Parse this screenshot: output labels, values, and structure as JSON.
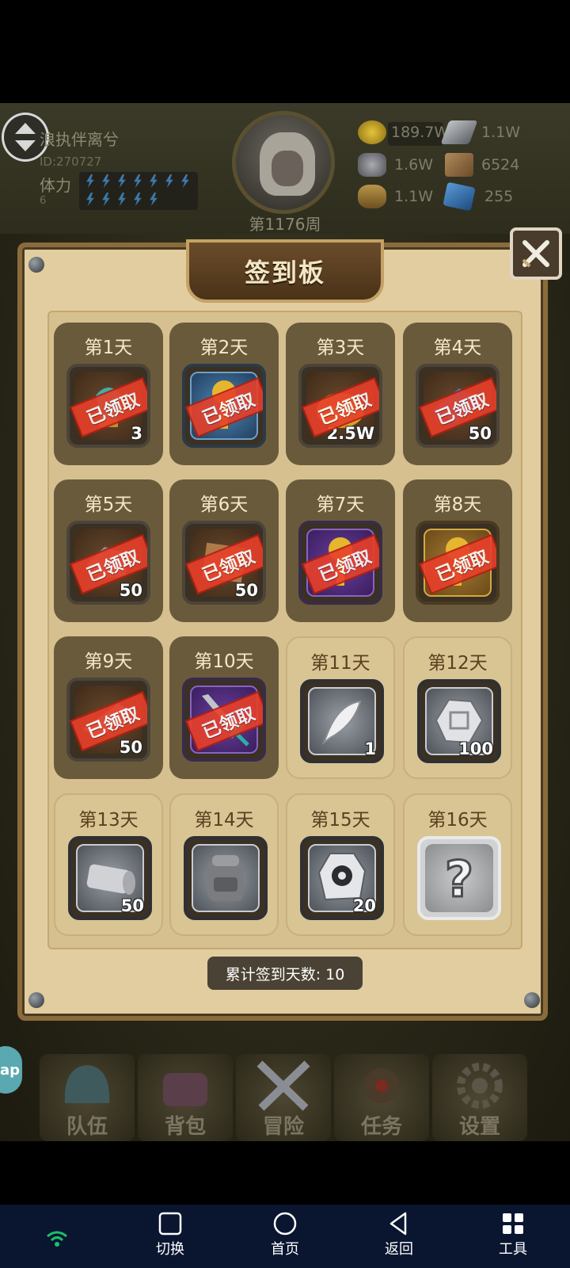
{
  "header": {
    "player_name": "浪执伴离兮",
    "player_id": "ID:270727",
    "stamina_label": "体力",
    "stamina_value": "6",
    "week_label": "第1176周"
  },
  "resources": [
    {
      "name": "gold",
      "value": "189.7W"
    },
    {
      "name": "iron-ingot",
      "value": "1.1W"
    },
    {
      "name": "stone",
      "value": "1.6W"
    },
    {
      "name": "cloth",
      "value": "6524"
    },
    {
      "name": "wood",
      "value": "1.1W"
    },
    {
      "name": "crystal",
      "value": "255"
    }
  ],
  "panel": {
    "title": "签到板",
    "total_label": "累计签到天数: 10",
    "claimed_stamp": "已领取"
  },
  "days": [
    {
      "label": "第1天",
      "qty": "3",
      "claimed": true,
      "icon": "gem-trophy-icon"
    },
    {
      "label": "第2天",
      "qty": "",
      "claimed": true,
      "icon": "key-icon"
    },
    {
      "label": "第3天",
      "qty": "2.5W",
      "claimed": true,
      "icon": "gold-bag-icon"
    },
    {
      "label": "第4天",
      "qty": "50",
      "claimed": true,
      "icon": "crystal-ore-icon"
    },
    {
      "label": "第5天",
      "qty": "50",
      "claimed": true,
      "icon": "stone-ore-icon"
    },
    {
      "label": "第6天",
      "qty": "50",
      "claimed": true,
      "icon": "cloth-icon"
    },
    {
      "label": "第7天",
      "qty": "",
      "claimed": true,
      "icon": "key-icon"
    },
    {
      "label": "第8天",
      "qty": "",
      "claimed": true,
      "icon": "key-icon"
    },
    {
      "label": "第9天",
      "qty": "50",
      "claimed": true,
      "icon": "iron-ingot-icon"
    },
    {
      "label": "第10天",
      "qty": "",
      "claimed": true,
      "icon": "dagger-icon"
    },
    {
      "label": "第11天",
      "qty": "1",
      "claimed": false,
      "icon": "feather-icon"
    },
    {
      "label": "第12天",
      "qty": "100",
      "claimed": false,
      "icon": "silver-ore-icon"
    },
    {
      "label": "第13天",
      "qty": "50",
      "claimed": false,
      "icon": "log-icon"
    },
    {
      "label": "第14天",
      "qty": "",
      "claimed": false,
      "icon": "backpack-icon"
    },
    {
      "label": "第15天",
      "qty": "20",
      "claimed": false,
      "icon": "rune-stone-icon"
    },
    {
      "label": "第16天",
      "qty": "",
      "claimed": false,
      "icon": "mystery-icon"
    }
  ],
  "side_tab": "ap",
  "bottom_menu": [
    {
      "label": "队伍",
      "icon": "helmet-icon"
    },
    {
      "label": "背包",
      "icon": "bag-icon"
    },
    {
      "label": "冒险",
      "icon": "crossed-swords-icon"
    },
    {
      "label": "任务",
      "icon": "task-icon"
    },
    {
      "label": "设置",
      "icon": "gear-icon"
    }
  ],
  "navbar": {
    "switch": "切换",
    "home": "首页",
    "back": "返回",
    "tools": "工具"
  },
  "colors": {
    "stamp": "#e8402a",
    "panel": "#e2cda0",
    "navbar": "#0a1530"
  }
}
